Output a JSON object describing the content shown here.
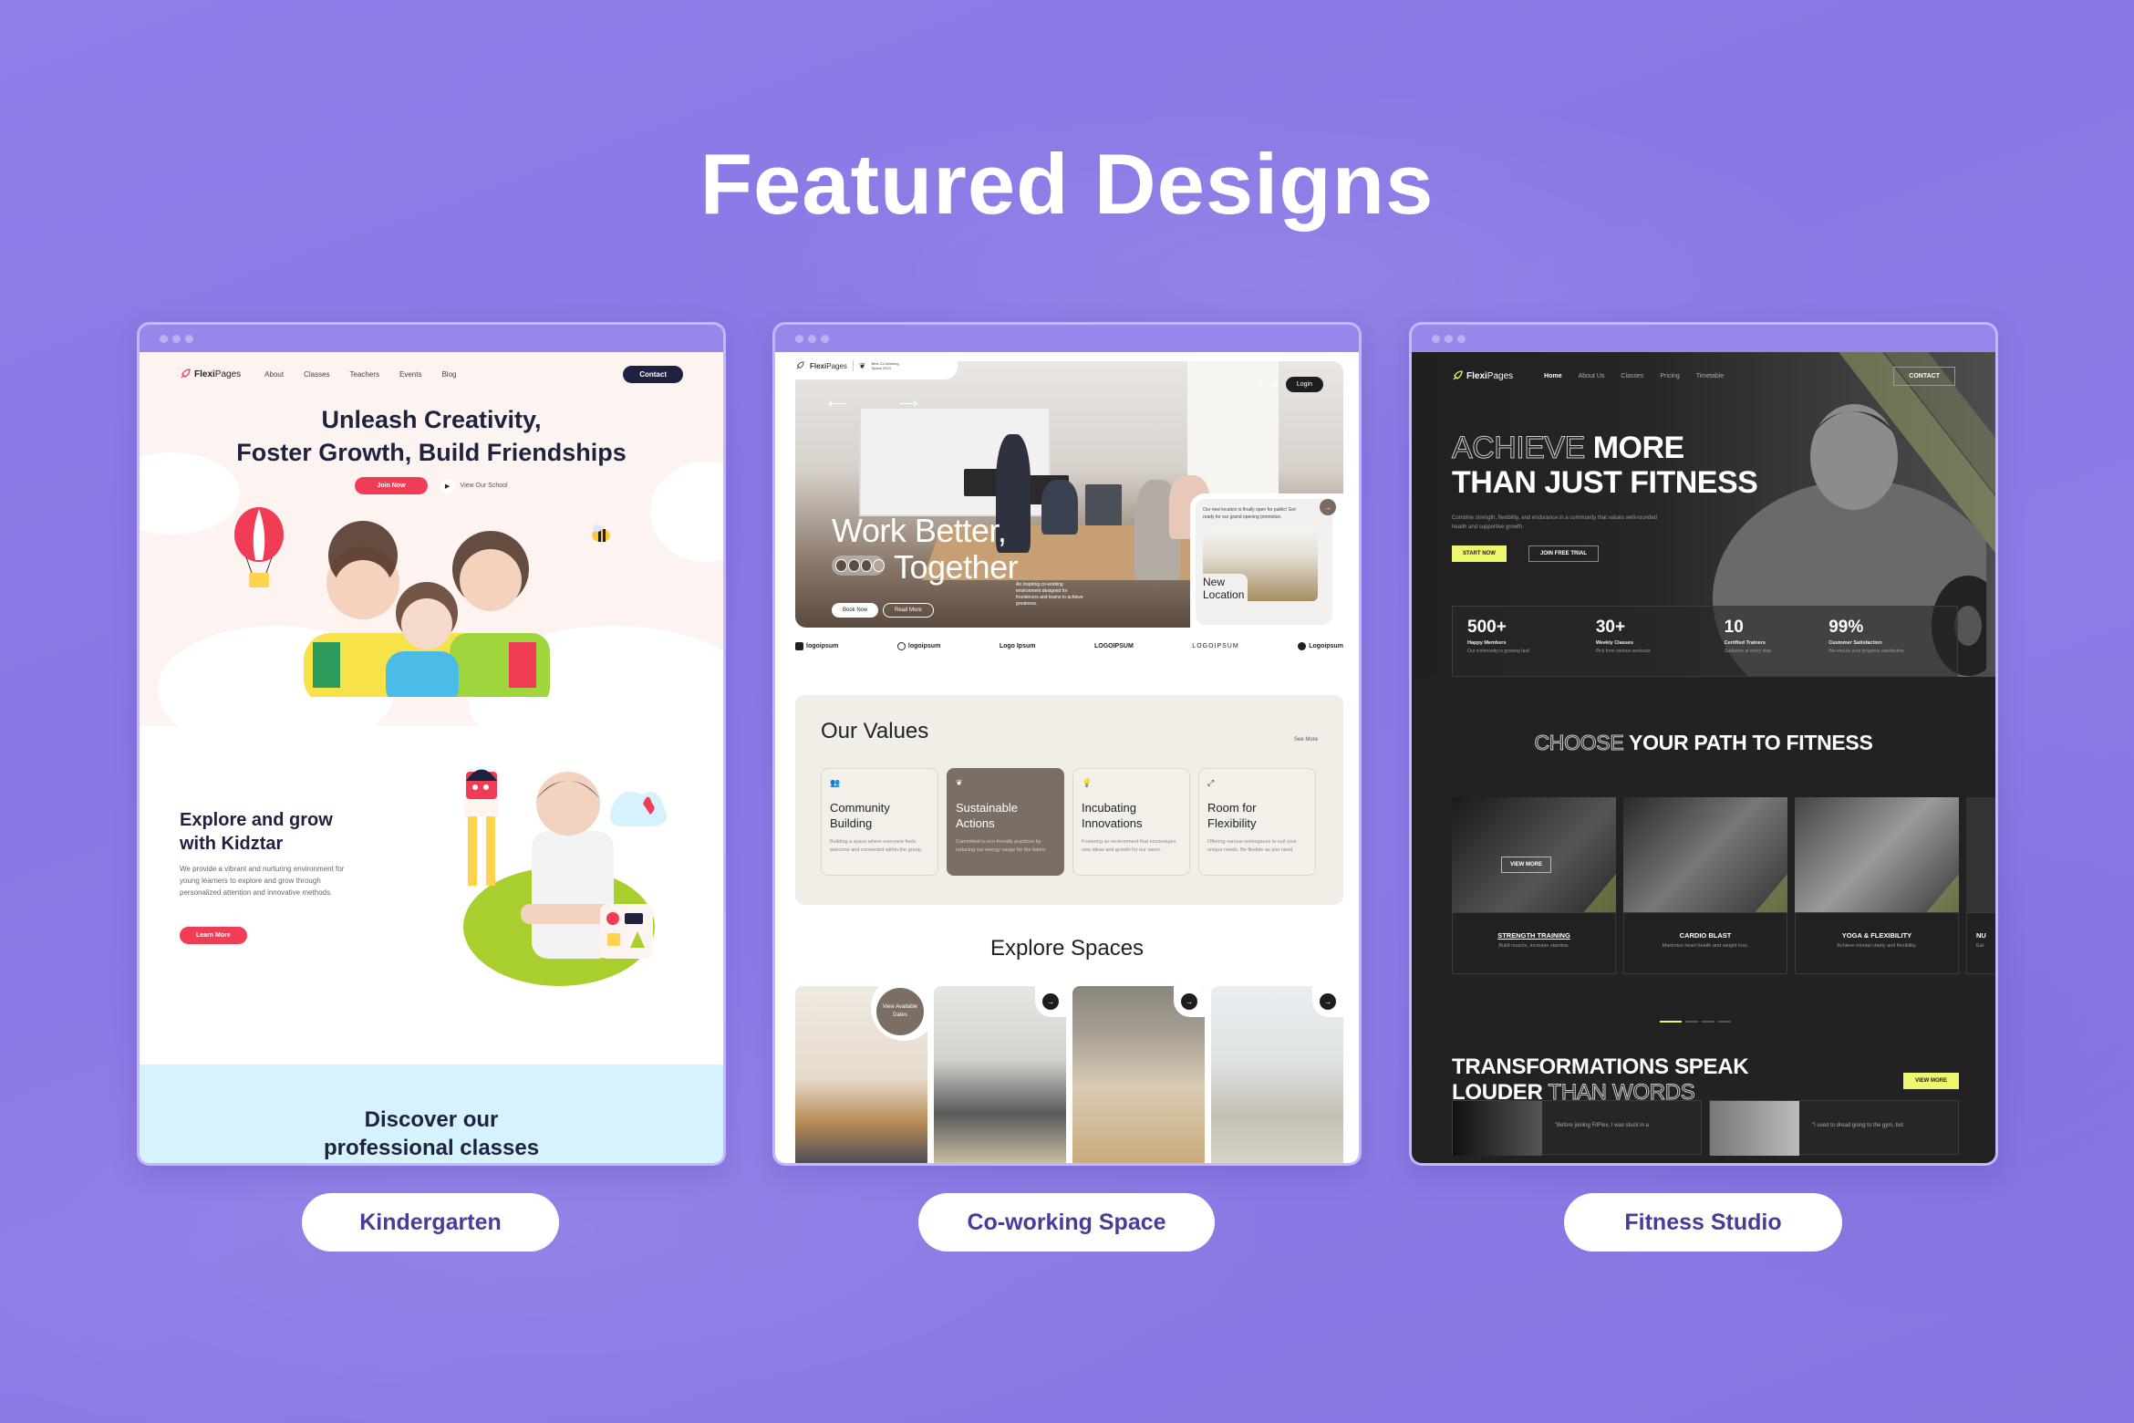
{
  "page_title": "Featured Designs",
  "designs": [
    {
      "label": "Kindergarten",
      "site": {
        "brand": "FlexiPages",
        "brand_bold": "Flexi",
        "brand_light": "Pages",
        "nav": [
          "About",
          "Classes",
          "Teachers",
          "Events",
          "Blog"
        ],
        "contact_button": "Contact",
        "hero_title_line1": "Unleash Creativity,",
        "hero_title_line2": "Foster Growth, Build Friendships",
        "join_button": "Join Now",
        "view_school_link": "View Our School",
        "section2_title_line1": "Explore and grow",
        "section2_title_line2": "with Kidztar",
        "section2_text": "We provide a vibrant and nurturing environment for young learners to explore and grow through personalized attention and innovative methods.",
        "learn_more_button": "Learn More",
        "section3_title_line1": "Discover our",
        "section3_title_line2": "professional classes"
      }
    },
    {
      "label": "Co-working Space",
      "site": {
        "brand": "FlexiPages",
        "brand_bold": "Flexi",
        "brand_light": "Pages",
        "award": "Best Co-Working Space 2023",
        "login_button": "Login",
        "hero_line1": "Work Better,",
        "hero_line2": "Together",
        "book_button": "Book Now",
        "read_button": "Read More",
        "hero_desc": "An inspiring co-working environment designed for freelancers and teams to achieve greatness.",
        "side_text": "Our new location is finally open for public! Get ready for our grand opening promotion.",
        "side_title_line1": "New",
        "side_title_line2": "Location",
        "logos": [
          "logoipsum",
          "logoipsum",
          "Logo Ipsum",
          "LOGOIPSUM",
          "LOGOIPSUM",
          "Logoipsum"
        ],
        "values_title": "Our Values",
        "see_more": "See More",
        "values": [
          {
            "icon": "community-icon",
            "glyph": "👥",
            "title_line1": "Community",
            "title_line2": "Building",
            "text": "Building a space where everyone feels welcome and connected within the group.",
            "active": false
          },
          {
            "icon": "leaf-icon",
            "glyph": "❦",
            "title_line1": "Sustainable",
            "title_line2": "Actions",
            "text": "Committed to eco-friendly practices by reducing our energy usage for the future.",
            "active": true
          },
          {
            "icon": "lightbulb-icon",
            "glyph": "💡",
            "title_line1": "Incubating",
            "title_line2": "Innovations",
            "text": "Fostering an environment that encourages new ideas and growth for our users.",
            "active": false
          },
          {
            "icon": "expand-icon",
            "glyph": "⤢",
            "title_line1": "Room for",
            "title_line2": "Flexibility",
            "text": "Offering various workspaces to suit your unique needs. Be flexible as you need.",
            "active": false
          }
        ],
        "explore_title": "Explore Spaces",
        "view_dates": "View Available Dates"
      }
    },
    {
      "label": "Fitness Studio",
      "site": {
        "brand": "FlexiPages",
        "brand_bold": "Flexi",
        "brand_light": "Pages",
        "nav": [
          "Home",
          "About Us",
          "Classes",
          "Pricing",
          "Timetable"
        ],
        "contact_button": "CONTACT",
        "hero_outline": "ACHIEVE",
        "hero_rest1": " MORE",
        "hero_line2": "THAN JUST FITNESS",
        "hero_desc": "Combine strength, flexibility, and endurance in a community that values well-rounded health and supportive growth.",
        "start_button": "START NOW",
        "trial_button": "JOIN FREE TRIAL",
        "stats": [
          {
            "value": "500+",
            "label": "Happy Members",
            "sub": "Our community is growing fast!"
          },
          {
            "value": "30+",
            "label": "Weekly Classes",
            "sub": "Pick from various workouts"
          },
          {
            "value": "10",
            "label": "Certified Trainers",
            "sub": "Guidance at every step."
          },
          {
            "value": "99%",
            "label": "Customer Satisfaction",
            "sub": "We ensure your progress satisfaction"
          }
        ],
        "choose_outline": "CHOOSE",
        "choose_rest": " YOUR PATH TO FITNESS",
        "classes": [
          {
            "title": "STRENGTH TRAINING",
            "text": "Build muscle, increase stamina."
          },
          {
            "title": "CARDIO BLAST",
            "text": "Maximize heart health and weight loss."
          },
          {
            "title": "YOGA & FLEXIBILITY",
            "text": "Achieve mental clarity and flexibility."
          },
          {
            "title": "NU",
            "text": "Eat"
          }
        ],
        "card_view_more": "VIEW MORE",
        "carousel_active_index": 0,
        "carousel_count": 4,
        "trans_line1": "TRANSFORMATIONS SPEAK",
        "trans_line2a": "LOUDER",
        "trans_line2b": " THAN WORDS",
        "view_more_button": "VIEW MORE",
        "testimonials": [
          "\"Before joining FitFlex, I was stuck in a",
          "\"I used to dread going to the gym, but"
        ]
      }
    }
  ],
  "colors": {
    "background": "#8c7ae6",
    "kg_accent": "#f03c55",
    "kg_dark": "#1f2140",
    "cw_accent": "#7b6e65",
    "ft_accent": "#eef56e",
    "pill_text": "#4a3a9c"
  }
}
